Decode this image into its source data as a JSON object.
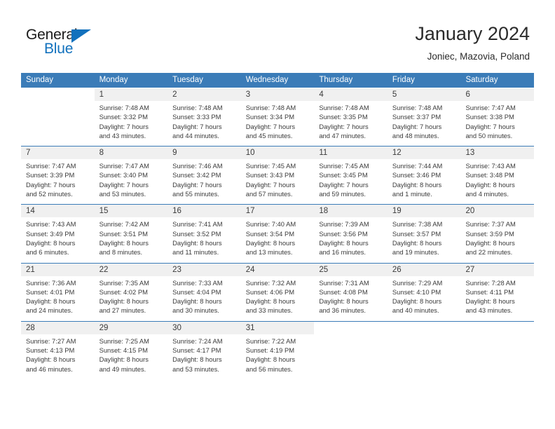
{
  "brand": {
    "name_part1": "General",
    "name_part2": "Blue",
    "triangle_color": "#1271bd",
    "text_color": "#1a1a1a"
  },
  "header": {
    "title": "January 2024",
    "subtitle": "Joniec, Mazovia, Poland"
  },
  "theme": {
    "header_blue": "#3b7cb8",
    "day_band_gray": "#f0f0f0",
    "text_color": "#3a3a3a"
  },
  "weekdays": [
    "Sunday",
    "Monday",
    "Tuesday",
    "Wednesday",
    "Thursday",
    "Friday",
    "Saturday"
  ],
  "weeks": [
    [
      {
        "day": "",
        "empty": true,
        "lines": []
      },
      {
        "day": "1",
        "lines": [
          "Sunrise: 7:48 AM",
          "Sunset: 3:32 PM",
          "Daylight: 7 hours",
          "and 43 minutes."
        ]
      },
      {
        "day": "2",
        "lines": [
          "Sunrise: 7:48 AM",
          "Sunset: 3:33 PM",
          "Daylight: 7 hours",
          "and 44 minutes."
        ]
      },
      {
        "day": "3",
        "lines": [
          "Sunrise: 7:48 AM",
          "Sunset: 3:34 PM",
          "Daylight: 7 hours",
          "and 45 minutes."
        ]
      },
      {
        "day": "4",
        "lines": [
          "Sunrise: 7:48 AM",
          "Sunset: 3:35 PM",
          "Daylight: 7 hours",
          "and 47 minutes."
        ]
      },
      {
        "day": "5",
        "lines": [
          "Sunrise: 7:48 AM",
          "Sunset: 3:37 PM",
          "Daylight: 7 hours",
          "and 48 minutes."
        ]
      },
      {
        "day": "6",
        "lines": [
          "Sunrise: 7:47 AM",
          "Sunset: 3:38 PM",
          "Daylight: 7 hours",
          "and 50 minutes."
        ]
      }
    ],
    [
      {
        "day": "7",
        "lines": [
          "Sunrise: 7:47 AM",
          "Sunset: 3:39 PM",
          "Daylight: 7 hours",
          "and 52 minutes."
        ]
      },
      {
        "day": "8",
        "lines": [
          "Sunrise: 7:47 AM",
          "Sunset: 3:40 PM",
          "Daylight: 7 hours",
          "and 53 minutes."
        ]
      },
      {
        "day": "9",
        "lines": [
          "Sunrise: 7:46 AM",
          "Sunset: 3:42 PM",
          "Daylight: 7 hours",
          "and 55 minutes."
        ]
      },
      {
        "day": "10",
        "lines": [
          "Sunrise: 7:45 AM",
          "Sunset: 3:43 PM",
          "Daylight: 7 hours",
          "and 57 minutes."
        ]
      },
      {
        "day": "11",
        "lines": [
          "Sunrise: 7:45 AM",
          "Sunset: 3:45 PM",
          "Daylight: 7 hours",
          "and 59 minutes."
        ]
      },
      {
        "day": "12",
        "lines": [
          "Sunrise: 7:44 AM",
          "Sunset: 3:46 PM",
          "Daylight: 8 hours",
          "and 1 minute."
        ]
      },
      {
        "day": "13",
        "lines": [
          "Sunrise: 7:43 AM",
          "Sunset: 3:48 PM",
          "Daylight: 8 hours",
          "and 4 minutes."
        ]
      }
    ],
    [
      {
        "day": "14",
        "lines": [
          "Sunrise: 7:43 AM",
          "Sunset: 3:49 PM",
          "Daylight: 8 hours",
          "and 6 minutes."
        ]
      },
      {
        "day": "15",
        "lines": [
          "Sunrise: 7:42 AM",
          "Sunset: 3:51 PM",
          "Daylight: 8 hours",
          "and 8 minutes."
        ]
      },
      {
        "day": "16",
        "lines": [
          "Sunrise: 7:41 AM",
          "Sunset: 3:52 PM",
          "Daylight: 8 hours",
          "and 11 minutes."
        ]
      },
      {
        "day": "17",
        "lines": [
          "Sunrise: 7:40 AM",
          "Sunset: 3:54 PM",
          "Daylight: 8 hours",
          "and 13 minutes."
        ]
      },
      {
        "day": "18",
        "lines": [
          "Sunrise: 7:39 AM",
          "Sunset: 3:56 PM",
          "Daylight: 8 hours",
          "and 16 minutes."
        ]
      },
      {
        "day": "19",
        "lines": [
          "Sunrise: 7:38 AM",
          "Sunset: 3:57 PM",
          "Daylight: 8 hours",
          "and 19 minutes."
        ]
      },
      {
        "day": "20",
        "lines": [
          "Sunrise: 7:37 AM",
          "Sunset: 3:59 PM",
          "Daylight: 8 hours",
          "and 22 minutes."
        ]
      }
    ],
    [
      {
        "day": "21",
        "lines": [
          "Sunrise: 7:36 AM",
          "Sunset: 4:01 PM",
          "Daylight: 8 hours",
          "and 24 minutes."
        ]
      },
      {
        "day": "22",
        "lines": [
          "Sunrise: 7:35 AM",
          "Sunset: 4:02 PM",
          "Daylight: 8 hours",
          "and 27 minutes."
        ]
      },
      {
        "day": "23",
        "lines": [
          "Sunrise: 7:33 AM",
          "Sunset: 4:04 PM",
          "Daylight: 8 hours",
          "and 30 minutes."
        ]
      },
      {
        "day": "24",
        "lines": [
          "Sunrise: 7:32 AM",
          "Sunset: 4:06 PM",
          "Daylight: 8 hours",
          "and 33 minutes."
        ]
      },
      {
        "day": "25",
        "lines": [
          "Sunrise: 7:31 AM",
          "Sunset: 4:08 PM",
          "Daylight: 8 hours",
          "and 36 minutes."
        ]
      },
      {
        "day": "26",
        "lines": [
          "Sunrise: 7:29 AM",
          "Sunset: 4:10 PM",
          "Daylight: 8 hours",
          "and 40 minutes."
        ]
      },
      {
        "day": "27",
        "lines": [
          "Sunrise: 7:28 AM",
          "Sunset: 4:11 PM",
          "Daylight: 8 hours",
          "and 43 minutes."
        ]
      }
    ],
    [
      {
        "day": "28",
        "lines": [
          "Sunrise: 7:27 AM",
          "Sunset: 4:13 PM",
          "Daylight: 8 hours",
          "and 46 minutes."
        ]
      },
      {
        "day": "29",
        "lines": [
          "Sunrise: 7:25 AM",
          "Sunset: 4:15 PM",
          "Daylight: 8 hours",
          "and 49 minutes."
        ]
      },
      {
        "day": "30",
        "lines": [
          "Sunrise: 7:24 AM",
          "Sunset: 4:17 PM",
          "Daylight: 8 hours",
          "and 53 minutes."
        ]
      },
      {
        "day": "31",
        "lines": [
          "Sunrise: 7:22 AM",
          "Sunset: 4:19 PM",
          "Daylight: 8 hours",
          "and 56 minutes."
        ]
      },
      {
        "day": "",
        "empty": true,
        "lines": []
      },
      {
        "day": "",
        "empty": true,
        "lines": []
      },
      {
        "day": "",
        "empty": true,
        "lines": []
      }
    ]
  ]
}
